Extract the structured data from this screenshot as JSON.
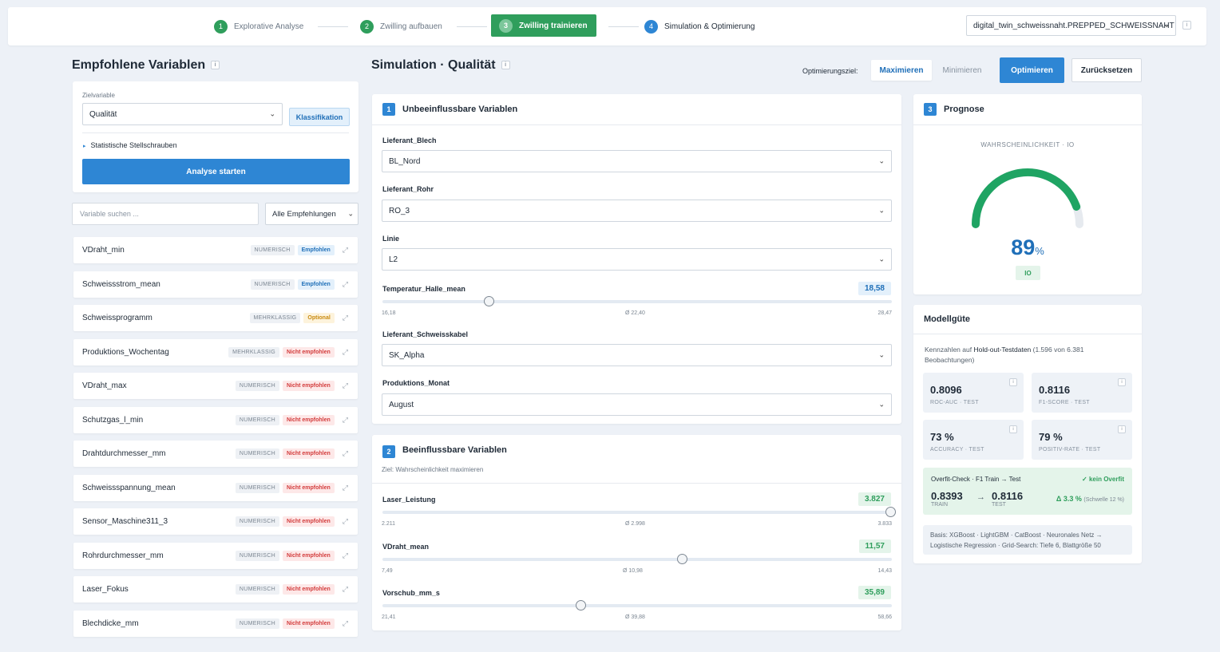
{
  "stepper": {
    "steps": [
      {
        "num": "1",
        "label": "Explorative Analyse"
      },
      {
        "num": "2",
        "label": "Zwilling aufbauen"
      },
      {
        "num": "3",
        "label": "Zwilling trainieren"
      },
      {
        "num": "4",
        "label": "Simulation & Optimierung"
      }
    ],
    "dataset": "digital_twin_schweissnaht.PREPPED_SCHWEISSNAHT",
    "info": "i"
  },
  "left": {
    "title": "Empfohlene Variablen",
    "info": "i",
    "ziel_label": "Zielvariable",
    "ziel_value": "Qualität",
    "ziel_badge": "Klassifikation",
    "stat_link": "Statistische Stellschrauben",
    "analyse_button": "Analyse starten",
    "search_placeholder": "Variable suchen ...",
    "filter_value": "Alle Empfehlungen",
    "variables": [
      {
        "name": "VDraht_min",
        "type": "NUMERISCH",
        "rec": "Empfohlen",
        "cls": "emp"
      },
      {
        "name": "Schweissstrom_mean",
        "type": "NUMERISCH",
        "rec": "Empfohlen",
        "cls": "emp"
      },
      {
        "name": "Schweissprogramm",
        "type": "MEHRKLASSIG",
        "rec": "Optional",
        "cls": "opt"
      },
      {
        "name": "Produktions_Wochentag",
        "type": "MEHRKLASSIG",
        "rec": "Nicht empfohlen",
        "cls": "nicht"
      },
      {
        "name": "VDraht_max",
        "type": "NUMERISCH",
        "rec": "Nicht empfohlen",
        "cls": "nicht"
      },
      {
        "name": "Schutzgas_l_min",
        "type": "NUMERISCH",
        "rec": "Nicht empfohlen",
        "cls": "nicht"
      },
      {
        "name": "Drahtdurchmesser_mm",
        "type": "NUMERISCH",
        "rec": "Nicht empfohlen",
        "cls": "nicht"
      },
      {
        "name": "Schweissspannung_mean",
        "type": "NUMERISCH",
        "rec": "Nicht empfohlen",
        "cls": "nicht"
      },
      {
        "name": "Sensor_Maschine311_3",
        "type": "NUMERISCH",
        "rec": "Nicht empfohlen",
        "cls": "nicht"
      },
      {
        "name": "Rohrdurchmesser_mm",
        "type": "NUMERISCH",
        "rec": "Nicht empfohlen",
        "cls": "nicht"
      },
      {
        "name": "Laser_Fokus",
        "type": "NUMERISCH",
        "rec": "Nicht empfohlen",
        "cls": "nicht"
      },
      {
        "name": "Blechdicke_mm",
        "type": "NUMERISCH",
        "rec": "Nicht empfohlen",
        "cls": "nicht"
      }
    ]
  },
  "sim": {
    "title": "Simulation · Qualität",
    "info": "i",
    "ziel_label": "Optimierungsziel:",
    "maximize": "Maximieren",
    "minimize": "Minimieren",
    "optimize_button": "Optimieren",
    "reset_button": "Zurücksetzen"
  },
  "fixed": {
    "num": "1",
    "title": "Unbeeinflussbare Variablen",
    "lieferant_blech": {
      "label": "Lieferant_Blech",
      "value": "BL_Nord"
    },
    "lieferant_rohr": {
      "label": "Lieferant_Rohr",
      "value": "RO_3"
    },
    "linie": {
      "label": "Linie",
      "value": "L2"
    },
    "temperatur": {
      "label": "Temperatur_Halle_mean",
      "value": "18,58",
      "min": "16,18",
      "avg": "Ø 22,40",
      "max": "28,47",
      "level": 0.21
    },
    "schweisskabel": {
      "label": "Lieferant_Schweisskabel",
      "value": "SK_Alpha"
    },
    "monat": {
      "label": "Produktions_Monat",
      "value": "August"
    }
  },
  "control": {
    "num": "2",
    "title": "Beeinflussbare Variablen",
    "subtitle": "Ziel: Wahrscheinlichkeit maximieren",
    "laser": {
      "label": "Laser_Leistung",
      "value": "3.827",
      "min": "2.211",
      "avg": "Ø 2.998",
      "max": "3.833",
      "level": 0.997
    },
    "vdraht": {
      "label": "VDraht_mean",
      "value": "11,57",
      "min": "7,49",
      "avg": "Ø 10,98",
      "max": "14,43",
      "level": 0.588
    },
    "vorschub": {
      "label": "Vorschub_mm_s",
      "value": "35,89",
      "min": "21,41",
      "avg": "Ø 39,88",
      "max": "58,66",
      "level": 0.389
    }
  },
  "prognose": {
    "num": "3",
    "title": "Prognose",
    "gauge_label": "WAHRSCHEINLICHKEIT · IO",
    "value": 89,
    "pct": "89",
    "unit": "%",
    "class": "IO",
    "color": "#1fa463"
  },
  "modell": {
    "title": "Modellgüte",
    "desc_pre": "Kennzahlen auf ",
    "desc_bold": "Hold-out-Testdaten",
    "desc_post": " (1.596 von 6.381 Beobachtungen)",
    "metrics": [
      {
        "value": "0.8096",
        "label": "ROC-AUC · TEST"
      },
      {
        "value": "0.8116",
        "label": "F1-SCORE · TEST"
      },
      {
        "value": "73 %",
        "label": "ACCURACY · TEST"
      },
      {
        "value": "79 %",
        "label": "POSITIV-RATE · TEST"
      }
    ],
    "overfit_title": "Overfit-Check · F1 Train → Test",
    "overfit_status": "✓ kein Overfit",
    "train_value": "0.8393",
    "train_label": "TRAIN",
    "arrow": "→",
    "test_value": "0.8116",
    "test_label": "TEST",
    "delta": "Δ 3.3 %",
    "threshold": "(Schwelle 12 %)",
    "basis": "Basis: XGBoost · LightGBM · CatBoost · Neuronales Netz → Logistische Regression · Grid-Search: Tiefe 6, Blattgröße 50"
  }
}
